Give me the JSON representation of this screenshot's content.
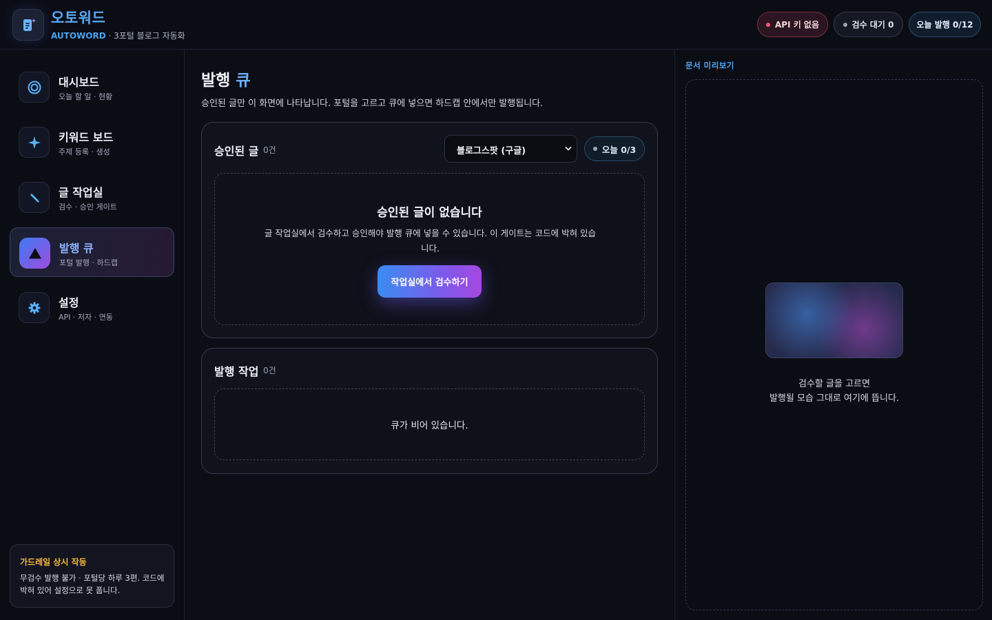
{
  "header": {
    "app_title": "오토워드",
    "brand": "AUTOWORD",
    "subtitle": " · 3포털 블로그 자동화",
    "pills": {
      "api": "API 키 없음",
      "review": "검수 대기 0",
      "today": "오늘 발행 0/12"
    }
  },
  "sidebar": {
    "items": [
      {
        "title": "대시보드",
        "sub": "오늘 할 일 · 현황",
        "icon": "target-icon"
      },
      {
        "title": "키워드 보드",
        "sub": "주제 등록 · 생성",
        "icon": "sparkle-icon"
      },
      {
        "title": "글 작업실",
        "sub": "검수 · 승인 게이트",
        "icon": "pencil-icon"
      },
      {
        "title": "발행 큐",
        "sub": "포털 발행 · 하드캡",
        "icon": "triangle-icon",
        "active": true
      },
      {
        "title": "설정",
        "sub": "API · 저자 · 연동",
        "icon": "gear-icon"
      }
    ],
    "guardrail": {
      "title": "가드레일 상시 작동",
      "text": "무검수 발행 불가 · 포털당 하루 3편. 코드에 박혀 있어 설정으로 못 풉니다."
    }
  },
  "main": {
    "title_prefix": "발행 ",
    "title_accent": "큐",
    "description": "승인된 글만 이 화면에 나타납니다. 포털을 고르고 큐에 넣으면 하드캡 안에서만 발행됩니다.",
    "approved": {
      "title": "승인된 글",
      "count": "0건",
      "portal_select": "블로그스팟 (구글)",
      "quota": "오늘 0/3",
      "empty_title": "승인된 글이 없습니다",
      "empty_desc": "글 작업실에서 검수하고 승인해야 발행 큐에 넣을 수 있습니다. 이 게이트는 코드에 박혀 있습니다.",
      "cta": "작업실에서 검수하기"
    },
    "jobs": {
      "title": "발행 작업",
      "count": "0건",
      "empty": "큐가 비어 있습니다."
    }
  },
  "preview": {
    "label": "문서 미리보기",
    "hint_line1": "검수할 글을 고르면",
    "hint_line2": "발행될 모습 그대로 여기에 뜹니다."
  },
  "colors": {
    "accent_blue": "#5aa9f5",
    "accent_purple": "#a547e0",
    "warning": "#f5b83d",
    "danger": "#ff5a6e"
  }
}
